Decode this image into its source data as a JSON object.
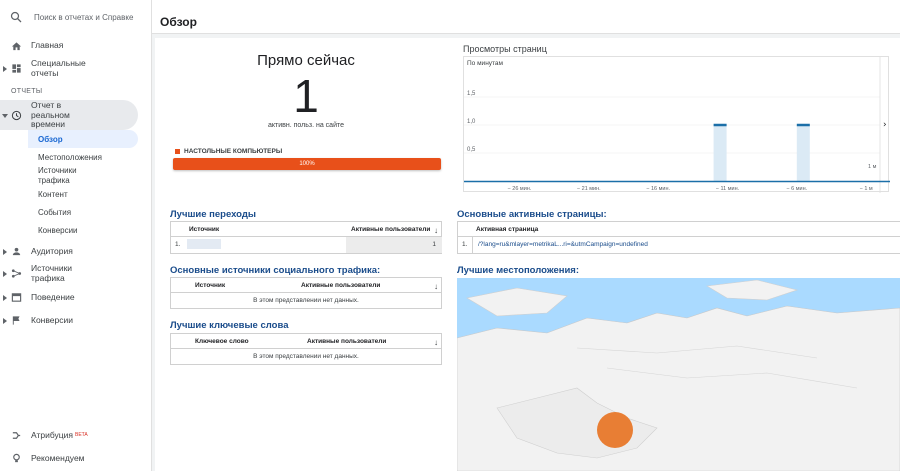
{
  "search": {
    "placeholder": "Поиск в отчетах и Справке"
  },
  "sidebar": {
    "items": [
      {
        "label": "Главная"
      },
      {
        "label": "Специальные\nотчеты"
      },
      {
        "label": "Отчет в\nреальном\nвремени"
      },
      {
        "label": "Аудитория"
      },
      {
        "label": "Источники\nтрафика"
      },
      {
        "label": "Поведение"
      },
      {
        "label": "Конверсии"
      }
    ],
    "section_label": "ОТЧЕТЫ",
    "sub_items": [
      {
        "label": "Обзор"
      },
      {
        "label": "Местоположения"
      },
      {
        "label": "Источники\nтрафика"
      },
      {
        "label": "Контент"
      },
      {
        "label": "События"
      },
      {
        "label": "Конверсии"
      }
    ],
    "bottom": [
      {
        "label": "Атрибуция",
        "badge": "BETA"
      },
      {
        "label": "Рекомендуем"
      }
    ]
  },
  "header": {
    "title": "Обзор"
  },
  "realtime": {
    "title": "Прямо сейчас",
    "active_users": "1",
    "subtitle": "активн. польз. на сайте",
    "device_label": "НАСТОЛЬНЫЕ КОМПЬЮТЕРЫ",
    "device_share": "100%",
    "device_fraction": 1.0,
    "colors": {
      "device": "#e8501a"
    }
  },
  "pageviews": {
    "title": "Просмотры страниц",
    "per_label": "По минутам"
  },
  "chart_data": {
    "type": "bar",
    "title": "Просмотры страниц",
    "subtitle": "По минутам",
    "ylim": [
      0,
      2
    ],
    "yticks": [
      "0,5",
      "1,0",
      "1,5"
    ],
    "xticks": [
      "− 26 мин.",
      "− 21 мин.",
      "− 16 мин.",
      "− 11 мин.",
      "− 6 мин.",
      "− 1 м",
      "1 м"
    ],
    "series": [
      {
        "values": [
          0,
          0,
          0,
          0,
          0,
          0,
          0,
          0,
          0,
          0,
          0,
          0,
          0,
          0,
          0,
          0,
          0,
          0,
          0,
          0,
          0,
          0,
          0,
          0,
          0,
          0,
          0,
          0,
          0,
          0
        ]
      }
    ],
    "bars": [
      {
        "minute": -12,
        "value": 1
      },
      {
        "minute": -6,
        "value": 1
      }
    ],
    "colors": {
      "bar": "#dbeaf5",
      "line": "#1b6fa8"
    }
  },
  "top_referrals": {
    "title": "Лучшие переходы",
    "headers": [
      "Источник",
      "Активные пользователи"
    ],
    "rows": [
      {
        "index": "1.",
        "value": "1"
      }
    ]
  },
  "top_pages": {
    "title": "Основные активные страницы:",
    "headers": [
      "Активная страница"
    ],
    "rows": [
      {
        "index": "1.",
        "url": "/?lang=ru&mlayer=metrikaL...ri=&utmCampaign=undefined"
      }
    ]
  },
  "social": {
    "title": "Основные источники социального трафика:",
    "headers": [
      "Источник",
      "Активные пользователи"
    ],
    "empty": "В этом представлении нет данных."
  },
  "locations": {
    "title": "Лучшие местоположения:"
  },
  "keywords": {
    "title": "Лучшие ключевые слова",
    "headers": [
      "Ключевое слово",
      "Активные пользователи"
    ],
    "empty": "В этом представлении нет данных."
  }
}
